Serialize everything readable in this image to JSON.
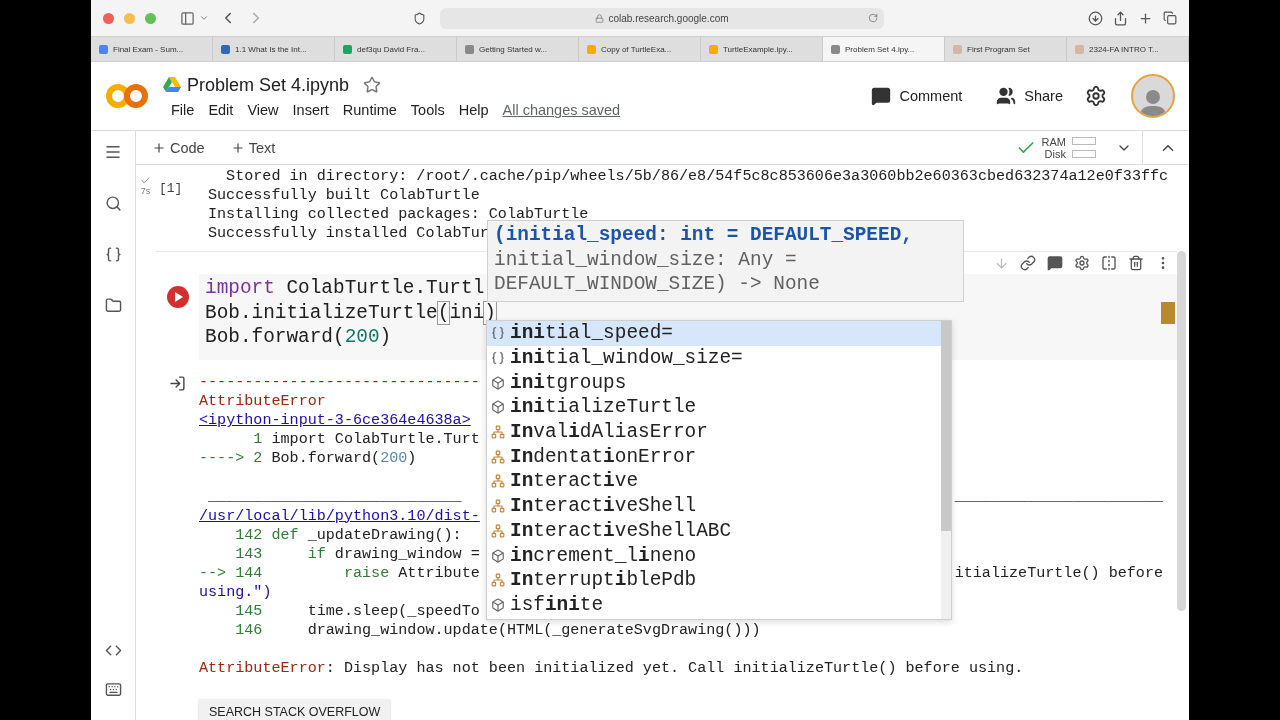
{
  "browser": {
    "url": "colab.research.google.com",
    "tabs": [
      {
        "label": "Final Exam - Sum...",
        "selected": false,
        "color": "#4a86e8"
      },
      {
        "label": "1.1 What Is the Int...",
        "selected": false,
        "color": "#2d6cb5"
      },
      {
        "label": "def3qu David Fra...",
        "selected": false,
        "color": "#1fa463"
      },
      {
        "label": "Getting Started w...",
        "selected": false,
        "color": "#8a8a8a"
      },
      {
        "label": "Copy of TurtleExa...",
        "selected": false,
        "color": "#f9ab00"
      },
      {
        "label": "TurtleExample.ipy...",
        "selected": false,
        "color": "#f9ab00"
      },
      {
        "label": "Problem Set 4.ipy...",
        "selected": true,
        "color": "#8a8a8a"
      },
      {
        "label": "First Program Set",
        "selected": false,
        "color": "#d8b4a4"
      },
      {
        "label": "2324-FA INTRO T...",
        "selected": false,
        "color": "#d8b4a4"
      }
    ]
  },
  "header": {
    "title": "Problem Set 4.ipynb",
    "menu": [
      "File",
      "Edit",
      "View",
      "Insert",
      "Runtime",
      "Tools",
      "Help"
    ],
    "save_status": "All changes saved",
    "comment": "Comment",
    "share": "Share"
  },
  "toolbar": {
    "add_code": "Code",
    "add_text": "Text",
    "ram": "RAM",
    "disk": "Disk"
  },
  "cells": [
    {
      "kind": "output_only",
      "exec": "[1]",
      "time": "7s",
      "output": [
        {
          "kind": "text",
          "tokens": [
            {
              "text": "  Stored in directory: /root/.cache/pip/wheels/5b/86/e8/54f5c8c853606e3a3060bb2e60363cbed632374a12e0f33ffc",
              "kind": "plain"
            }
          ]
        },
        {
          "kind": "text",
          "tokens": [
            {
              "text": "Successfully built ColabTurtle",
              "kind": "plain"
            }
          ]
        },
        {
          "kind": "text",
          "tokens": [
            {
              "text": "Installing collected packages: ColabTurtle",
              "kind": "plain"
            }
          ]
        },
        {
          "kind": "text",
          "tokens": [
            {
              "text": "Successfully installed ColabTur",
              "kind": "plain"
            }
          ]
        }
      ]
    },
    {
      "kind": "code",
      "code": [
        [
          {
            "text": "import",
            "kind": "keyword"
          },
          {
            "text": " ColabTurtle.Turtl",
            "kind": "plain"
          }
        ],
        [
          {
            "text": "Bob.initializeTurtle",
            "kind": "plain"
          },
          {
            "text": "(",
            "kind": "bracket"
          },
          {
            "text": "ini",
            "kind": "plain"
          },
          {
            "text": ")",
            "kind": "bracket"
          }
        ],
        [
          {
            "text": "Bob.forward",
            "kind": "plain"
          },
          {
            "text": "(",
            "kind": "plain"
          },
          {
            "text": "200",
            "kind": "number"
          },
          {
            "text": ")",
            "kind": "plain"
          }
        ]
      ],
      "output": [
        {
          "kind": "text",
          "tokens": [
            {
              "text": "-------------------------------",
              "kind": "error"
            }
          ]
        },
        {
          "kind": "text",
          "tokens": [
            {
              "text": "AttributeError",
              "kind": "error"
            }
          ]
        },
        {
          "kind": "link",
          "tokens": [
            {
              "text": "<ipython-input-3-6ce364e4638a>",
              "kind": "link"
            }
          ]
        },
        {
          "kind": "text",
          "tokens": [
            {
              "text": "      1",
              "kind": "green"
            },
            {
              "text": " import ColabTurtle.Turt",
              "kind": "plain"
            }
          ]
        },
        {
          "kind": "text",
          "tokens": [
            {
              "text": "----> 2",
              "kind": "green"
            },
            {
              "text": " Bob.forward(",
              "kind": "plain"
            },
            {
              "text": "200",
              "kind": "soft"
            },
            {
              "text": ")",
              "kind": "plain"
            }
          ]
        },
        {
          "kind": "blank"
        },
        {
          "kind": "text",
          "tokens": [
            {
              "text": " ____________________________",
              "kind": "plain"
            }
          ],
          "tail": "_______________________"
        },
        {
          "kind": "link",
          "tokens": [
            {
              "text": "/usr/local/lib/python3.10/dist-",
              "kind": "link"
            }
          ]
        },
        {
          "kind": "text",
          "tokens": [
            {
              "text": "    142 def",
              "kind": "green"
            },
            {
              "text": " _updateDrawing():",
              "kind": "plain"
            }
          ]
        },
        {
          "kind": "text",
          "tokens": [
            {
              "text": "    143     if",
              "kind": "green"
            },
            {
              "text": " drawing_window =",
              "kind": "plain"
            }
          ]
        },
        {
          "kind": "text",
          "tokens": [
            {
              "text": "--> 144         raise",
              "kind": "green"
            },
            {
              "text": " Attribute",
              "kind": "plain"
            }
          ],
          "tail": "itializeTurtle() before"
        },
        {
          "kind": "text",
          "tokens": [
            {
              "text": "using.\")",
              "kind": "link"
            }
          ]
        },
        {
          "kind": "text",
          "tokens": [
            {
              "text": "    145",
              "kind": "green"
            },
            {
              "text": "     time.sleep(_speedTo",
              "kind": "plain"
            }
          ]
        },
        {
          "kind": "text",
          "tokens": [
            {
              "text": "    146",
              "kind": "green"
            },
            {
              "text": "     drawing_window.update(HTML(_generateSvgDrawing()))",
              "kind": "plain"
            }
          ]
        },
        {
          "kind": "blank"
        },
        {
          "kind": "text",
          "tokens": [
            {
              "text": "AttributeError",
              "kind": "error"
            },
            {
              "text": ": Display has not been initialized yet. Call initializeTurtle() before using.",
              "kind": "plain"
            }
          ]
        }
      ],
      "button": "SEARCH STACK OVERFLOW",
      "signature": {
        "active": "(initial_speed: int = DEFAULT_SPEED,",
        "rest": [
          "initial_window_size: Any =",
          "DEFAULT_WINDOW_SIZE) -> None"
        ]
      },
      "completions": [
        {
          "label": "**ini**tial_speed=",
          "kind": "variable",
          "selected": true
        },
        {
          "label": "**ini**tial_window_size=",
          "kind": "variable",
          "selected": false
        },
        {
          "label": "**ini**tgroups",
          "kind": "module",
          "selected": false
        },
        {
          "label": "**ini**tializeTurtle",
          "kind": "module",
          "selected": false
        },
        {
          "label": "**In**val**i**dAliasError",
          "kind": "class",
          "selected": false
        },
        {
          "label": "**In**dentat**i**onError",
          "kind": "class",
          "selected": false
        },
        {
          "label": "**In**teract**i**ve",
          "kind": "class",
          "selected": false
        },
        {
          "label": "**In**teract**i**veShell",
          "kind": "class",
          "selected": false
        },
        {
          "label": "**In**teract**i**veShellABC",
          "kind": "class",
          "selected": false
        },
        {
          "label": "**in**crement_l**i**neno",
          "kind": "module",
          "selected": false
        },
        {
          "label": "**In**terrupt**i**blePdb",
          "kind": "class",
          "selected": false
        },
        {
          "label": "isf**ini**te",
          "kind": "module",
          "selected": false
        }
      ]
    }
  ]
}
